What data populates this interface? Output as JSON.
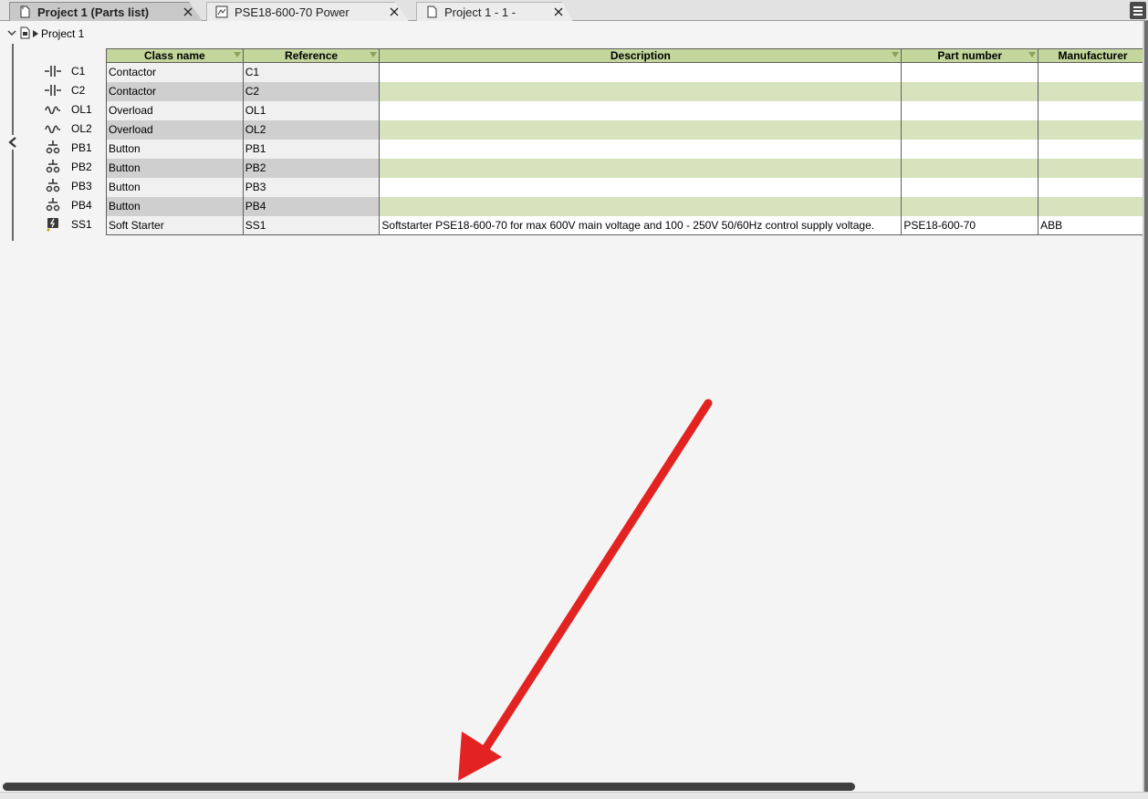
{
  "tabs": [
    {
      "label": "Project 1 (Parts list)",
      "icon": "document-icon",
      "active": true
    },
    {
      "label": "PSE18-600-70 Power",
      "icon": "schematic-icon",
      "active": false
    },
    {
      "label": "Project 1 - 1 -",
      "icon": "page-icon",
      "active": false
    }
  ],
  "tree": {
    "root_label": "Project 1"
  },
  "table": {
    "columns": [
      "Class name",
      "Reference",
      "Description",
      "Part number",
      "Manufacturer"
    ],
    "rows": [
      {
        "id": "C1",
        "icon": "contactor-icon",
        "class_name": "Contactor",
        "reference": "C1",
        "description": "",
        "part_number": "",
        "manufacturer": ""
      },
      {
        "id": "C2",
        "icon": "contactor-icon",
        "class_name": "Contactor",
        "reference": "C2",
        "description": "",
        "part_number": "",
        "manufacturer": ""
      },
      {
        "id": "OL1",
        "icon": "overload-icon",
        "class_name": "Overload",
        "reference": "OL1",
        "description": "",
        "part_number": "",
        "manufacturer": ""
      },
      {
        "id": "OL2",
        "icon": "overload-icon",
        "class_name": "Overload",
        "reference": "OL2",
        "description": "",
        "part_number": "",
        "manufacturer": ""
      },
      {
        "id": "PB1",
        "icon": "button-icon",
        "class_name": "Button",
        "reference": "PB1",
        "description": "",
        "part_number": "",
        "manufacturer": ""
      },
      {
        "id": "PB2",
        "icon": "button-icon",
        "class_name": "Button",
        "reference": "PB2",
        "description": "",
        "part_number": "",
        "manufacturer": ""
      },
      {
        "id": "PB3",
        "icon": "button-icon",
        "class_name": "Button",
        "reference": "PB3",
        "description": "",
        "part_number": "",
        "manufacturer": ""
      },
      {
        "id": "PB4",
        "icon": "button-icon",
        "class_name": "Button",
        "reference": "PB4",
        "description": "",
        "part_number": "",
        "manufacturer": ""
      },
      {
        "id": "SS1",
        "icon": "soft-starter-icon",
        "class_name": "Soft Starter",
        "reference": "SS1",
        "description": "Softstarter PSE18-600-70 for max 600V main voltage and 100 - 250V 50/60Hz control supply voltage.",
        "part_number": "PSE18-600-70",
        "manufacturer": "ABB"
      }
    ]
  },
  "colors": {
    "header_green": "#c3d69b",
    "row_alt_green": "#d6e3bc",
    "annotation_arrow": "#e32222",
    "scroll_thumb": "#3f3f3f"
  }
}
